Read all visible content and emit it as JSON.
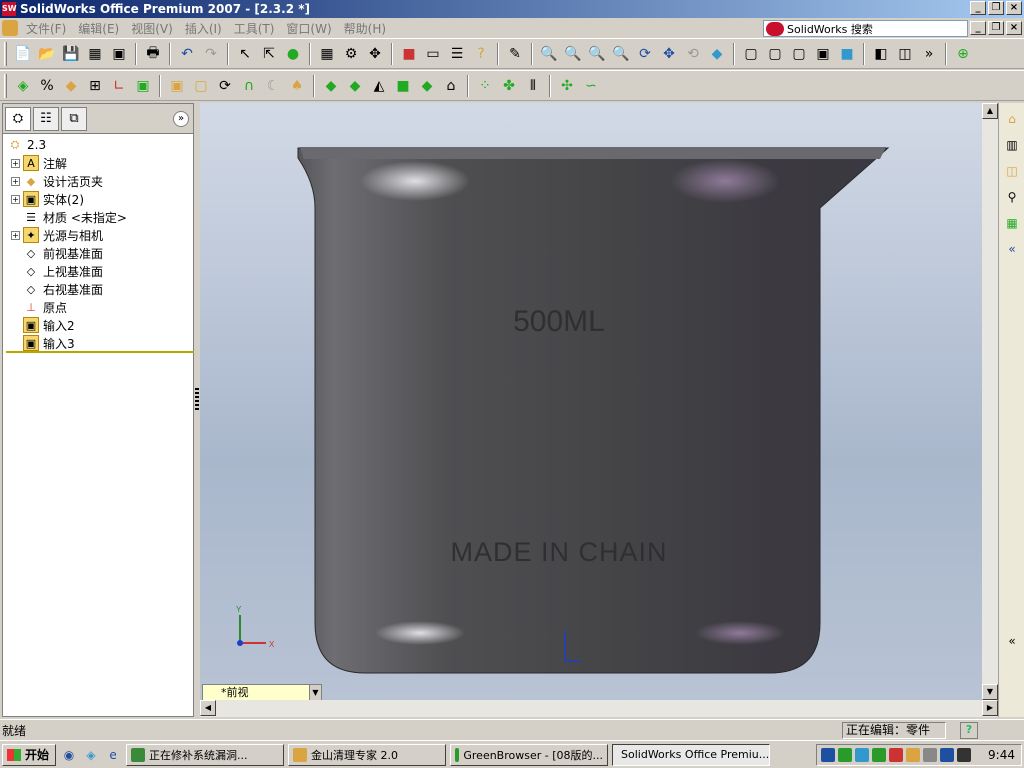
{
  "window": {
    "title": "SolidWorks Office Premium 2007 - [2.3.2 *]"
  },
  "menu": {
    "items": [
      "文件(F)",
      "编辑(E)",
      "视图(V)",
      "插入(I)",
      "工具(T)",
      "窗口(W)",
      "帮助(H)"
    ],
    "search_placeholder": "SolidWorks 搜索"
  },
  "tree": {
    "root": "2.3",
    "items": [
      {
        "label": "注解",
        "icon": "annotation-icon",
        "expandable": true
      },
      {
        "label": "设计活页夹",
        "icon": "design-binder-icon",
        "expandable": true
      },
      {
        "label": "实体(2)",
        "icon": "solid-bodies-icon",
        "expandable": true
      },
      {
        "label": "材质 <未指定>",
        "icon": "material-icon",
        "expandable": false
      },
      {
        "label": "光源与相机",
        "icon": "lights-cameras-icon",
        "expandable": true
      },
      {
        "label": "前视基准面",
        "icon": "plane-icon",
        "expandable": false
      },
      {
        "label": "上视基准面",
        "icon": "plane-icon",
        "expandable": false
      },
      {
        "label": "右视基准面",
        "icon": "plane-icon",
        "expandable": false
      },
      {
        "label": "原点",
        "icon": "origin-icon",
        "expandable": false
      },
      {
        "label": "输入2",
        "icon": "import-feature-icon",
        "expandable": false
      },
      {
        "label": "输入3",
        "icon": "import-feature-icon",
        "expandable": false
      }
    ]
  },
  "model": {
    "text_top": "500ML",
    "text_bottom": "MADE IN CHAIN"
  },
  "triad": {
    "y": "Y",
    "x": "X"
  },
  "view": {
    "name": "*前视"
  },
  "status": {
    "left": "就绪",
    "editing": "正在编辑：零件",
    "help": "?"
  },
  "taskbar": {
    "start": "开始",
    "tasks": [
      "正在修补系统漏洞...",
      "金山清理专家 2.0",
      "GreenBrowser - [08版的...",
      "SolidWorks Office Premiu..."
    ],
    "clock": "9:44"
  },
  "colors": {
    "titlebar_start": "#0a246a",
    "titlebar_end": "#a6caf0",
    "chrome": "#d4d0c8",
    "viewport": "#b8c3d4",
    "model": "#4a4a4e"
  }
}
